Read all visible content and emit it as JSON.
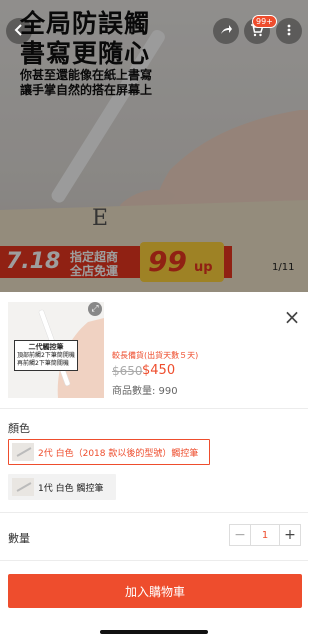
{
  "banner": {
    "headline_1": "全局防誤觸",
    "headline_2": "書寫更隨心",
    "sub_1": "你甚至還能像在紙上書寫",
    "sub_2": "讓手掌自然的搭在屏幕上",
    "promo_date": "7.18",
    "promo_text_1": "指定超商",
    "promo_text_2": "全店免運",
    "promo_price": "99",
    "promo_unit": "up",
    "page_indicator": "1/11",
    "cart_count": "99+"
  },
  "sheet": {
    "thumb_label_title": "二代觸控筆",
    "thumb_label_line1": "頂部前觸2下筆筒開機",
    "thumb_label_line2": "再前觸2下筆筒關機",
    "preparation": "較長備貨(出貨天數５天)",
    "old_price": "$650",
    "new_price": "$450",
    "stock": "商品數量: 990",
    "color_title": "顏色",
    "options": [
      {
        "label": "2代 白色（2018 款以後的型號）觸控筆",
        "selected": true
      },
      {
        "label": "1代 白色 觸控筆",
        "selected": false
      }
    ],
    "quantity_title": "數量",
    "quantity_value": "1",
    "add_to_cart": "加入購物車"
  },
  "colors": {
    "accent": "#ee4d2d",
    "promo_yellow": "#ffd23c"
  },
  "icons": [
    "back-icon",
    "share-icon",
    "cart-icon",
    "more-icon",
    "zoom-icon",
    "close-icon",
    "minus-icon",
    "plus-icon"
  ]
}
